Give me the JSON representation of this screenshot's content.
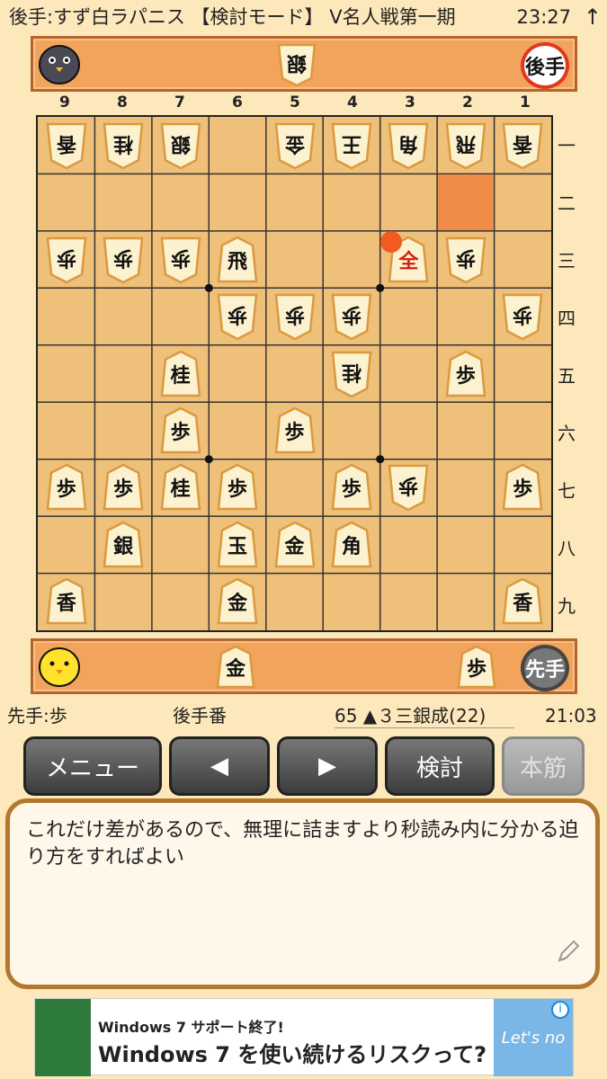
{
  "status_bar": {
    "title": "後手:すず白ラパニス 【検討モード】 V名人戦第一期",
    "time": "23:27",
    "icon": "up-arrow-icon"
  },
  "gote_stand": {
    "badge": "後手",
    "hand": [
      "銀"
    ]
  },
  "sente_stand": {
    "badge": "先手",
    "hand": [
      "金",
      "歩"
    ]
  },
  "board": {
    "files": [
      "9",
      "8",
      "7",
      "6",
      "5",
      "4",
      "3",
      "2",
      "1"
    ],
    "ranks": [
      "一",
      "二",
      "三",
      "四",
      "五",
      "六",
      "七",
      "八",
      "九"
    ],
    "pieces": [
      {
        "file": 9,
        "rank": 1,
        "name": "香",
        "owner": "gote"
      },
      {
        "file": 8,
        "rank": 1,
        "name": "桂",
        "owner": "gote"
      },
      {
        "file": 7,
        "rank": 1,
        "name": "銀",
        "owner": "gote"
      },
      {
        "file": 5,
        "rank": 1,
        "name": "金",
        "owner": "gote"
      },
      {
        "file": 4,
        "rank": 1,
        "name": "王",
        "owner": "gote"
      },
      {
        "file": 3,
        "rank": 1,
        "name": "角",
        "owner": "gote"
      },
      {
        "file": 2,
        "rank": 1,
        "name": "飛",
        "owner": "gote"
      },
      {
        "file": 1,
        "rank": 1,
        "name": "香",
        "owner": "gote"
      },
      {
        "file": 9,
        "rank": 3,
        "name": "歩",
        "owner": "gote"
      },
      {
        "file": 8,
        "rank": 3,
        "name": "歩",
        "owner": "gote"
      },
      {
        "file": 7,
        "rank": 3,
        "name": "歩",
        "owner": "gote"
      },
      {
        "file": 6,
        "rank": 3,
        "name": "飛",
        "owner": "sente"
      },
      {
        "file": 3,
        "rank": 3,
        "name": "全",
        "owner": "sente",
        "promoted": true
      },
      {
        "file": 2,
        "rank": 3,
        "name": "歩",
        "owner": "gote"
      },
      {
        "file": 6,
        "rank": 4,
        "name": "歩",
        "owner": "gote"
      },
      {
        "file": 5,
        "rank": 4,
        "name": "歩",
        "owner": "gote"
      },
      {
        "file": 4,
        "rank": 4,
        "name": "歩",
        "owner": "gote"
      },
      {
        "file": 1,
        "rank": 4,
        "name": "歩",
        "owner": "gote"
      },
      {
        "file": 7,
        "rank": 5,
        "name": "桂",
        "owner": "sente"
      },
      {
        "file": 4,
        "rank": 5,
        "name": "桂",
        "owner": "gote"
      },
      {
        "file": 2,
        "rank": 5,
        "name": "歩",
        "owner": "sente"
      },
      {
        "file": 7,
        "rank": 6,
        "name": "歩",
        "owner": "sente"
      },
      {
        "file": 5,
        "rank": 6,
        "name": "歩",
        "owner": "sente"
      },
      {
        "file": 9,
        "rank": 7,
        "name": "歩",
        "owner": "sente"
      },
      {
        "file": 8,
        "rank": 7,
        "name": "歩",
        "owner": "sente"
      },
      {
        "file": 7,
        "rank": 7,
        "name": "桂",
        "owner": "sente"
      },
      {
        "file": 6,
        "rank": 7,
        "name": "歩",
        "owner": "sente"
      },
      {
        "file": 4,
        "rank": 7,
        "name": "歩",
        "owner": "sente"
      },
      {
        "file": 3,
        "rank": 7,
        "name": "歩",
        "owner": "gote"
      },
      {
        "file": 1,
        "rank": 7,
        "name": "歩",
        "owner": "sente"
      },
      {
        "file": 8,
        "rank": 8,
        "name": "銀",
        "owner": "sente"
      },
      {
        "file": 6,
        "rank": 8,
        "name": "玉",
        "owner": "sente"
      },
      {
        "file": 5,
        "rank": 8,
        "name": "金",
        "owner": "sente"
      },
      {
        "file": 4,
        "rank": 8,
        "name": "角",
        "owner": "sente"
      },
      {
        "file": 9,
        "rank": 9,
        "name": "香",
        "owner": "sente"
      },
      {
        "file": 6,
        "rank": 9,
        "name": "金",
        "owner": "sente"
      },
      {
        "file": 1,
        "rank": 9,
        "name": "香",
        "owner": "sente"
      }
    ],
    "highlight": {
      "file": 2,
      "rank": 2
    },
    "last_move_marker": {
      "file": 3,
      "rank": 3
    }
  },
  "info_bar": {
    "sente_hand": "先手:歩",
    "turn": "後手番",
    "move": "65 ▲３三銀成(22)",
    "clock": "21:03"
  },
  "buttons": {
    "menu": "メニュー",
    "prev": "◀",
    "next": "▶",
    "analyze": "検討",
    "mainline": "本筋"
  },
  "comment": {
    "text": "これだけ差があるので、無理に詰ますより秒読み内に分かる迫り方をすればよい"
  },
  "ad": {
    "line1": "Windows 7 サポート終了!",
    "line2": "Windows 7 を使い続けるリスクって?",
    "brand": "Let's no",
    "info": "i"
  },
  "colors": {
    "board": "#efc07a",
    "stand": "#f2a35c",
    "highlight": "#ef8d48",
    "marker": "#f35a1f",
    "promoted_text": "#d02010"
  }
}
